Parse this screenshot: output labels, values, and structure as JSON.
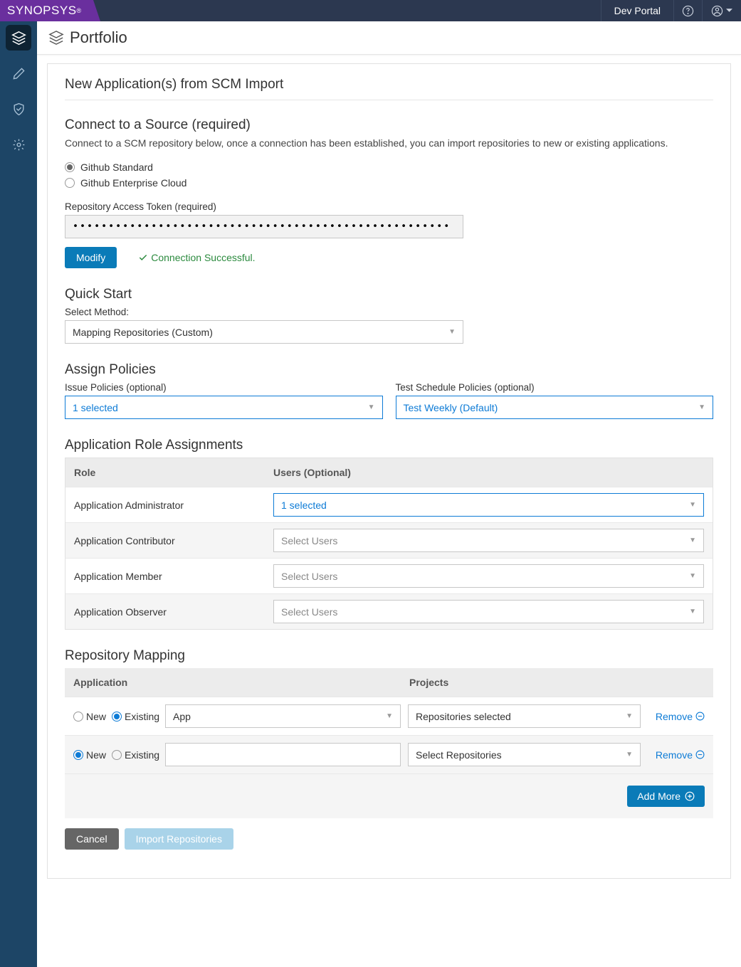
{
  "brand": "SYNOPSYS",
  "topbar": {
    "devPortal": "Dev Portal"
  },
  "pageTitle": "Portfolio",
  "panel": {
    "title": "New Application(s) from SCM Import",
    "connect": {
      "heading": "Connect to a Source (required)",
      "subtext": "Connect to a SCM repository below, once a connection has been established, you can import repositories to new or existing applications.",
      "optionStandard": "Github Standard",
      "optionEnterprise": "Github Enterprise Cloud",
      "tokenLabel": "Repository Access Token (required)",
      "tokenValue": "•••••••••••••••••••••••••••••••••••••••••••••••••••••",
      "modifyBtn": "Modify",
      "successMsg": "Connection Successful."
    },
    "quickstart": {
      "heading": "Quick Start",
      "label": "Select Method:",
      "value": "Mapping Repositories (Custom)"
    },
    "policies": {
      "heading": "Assign Policies",
      "issueLabel": "Issue Policies (optional)",
      "issueValue": "1 selected",
      "scheduleLabel": "Test Schedule Policies (optional)",
      "scheduleValue": "Test Weekly (Default)"
    },
    "roles": {
      "heading": "Application Role Assignments",
      "colRole": "Role",
      "colUsers": "Users (Optional)",
      "rows": [
        {
          "role": "Application Administrator",
          "value": "1 selected",
          "selected": true
        },
        {
          "role": "Application Contributor",
          "value": "Select Users",
          "selected": false
        },
        {
          "role": "Application Member",
          "value": "Select Users",
          "selected": false
        },
        {
          "role": "Application Observer",
          "value": "Select Users",
          "selected": false
        }
      ]
    },
    "mapping": {
      "heading": "Repository Mapping",
      "colApp": "Application",
      "colProj": "Projects",
      "labelNew": "New",
      "labelExisting": "Existing",
      "row0AppValue": "App",
      "row0ProjValue": "Repositories selected",
      "row1AppValue": "",
      "row1ProjValue": "Select Repositories",
      "removeLabel": "Remove",
      "addMore": "Add More"
    },
    "footer": {
      "cancel": "Cancel",
      "import": "Import Repositories"
    }
  }
}
